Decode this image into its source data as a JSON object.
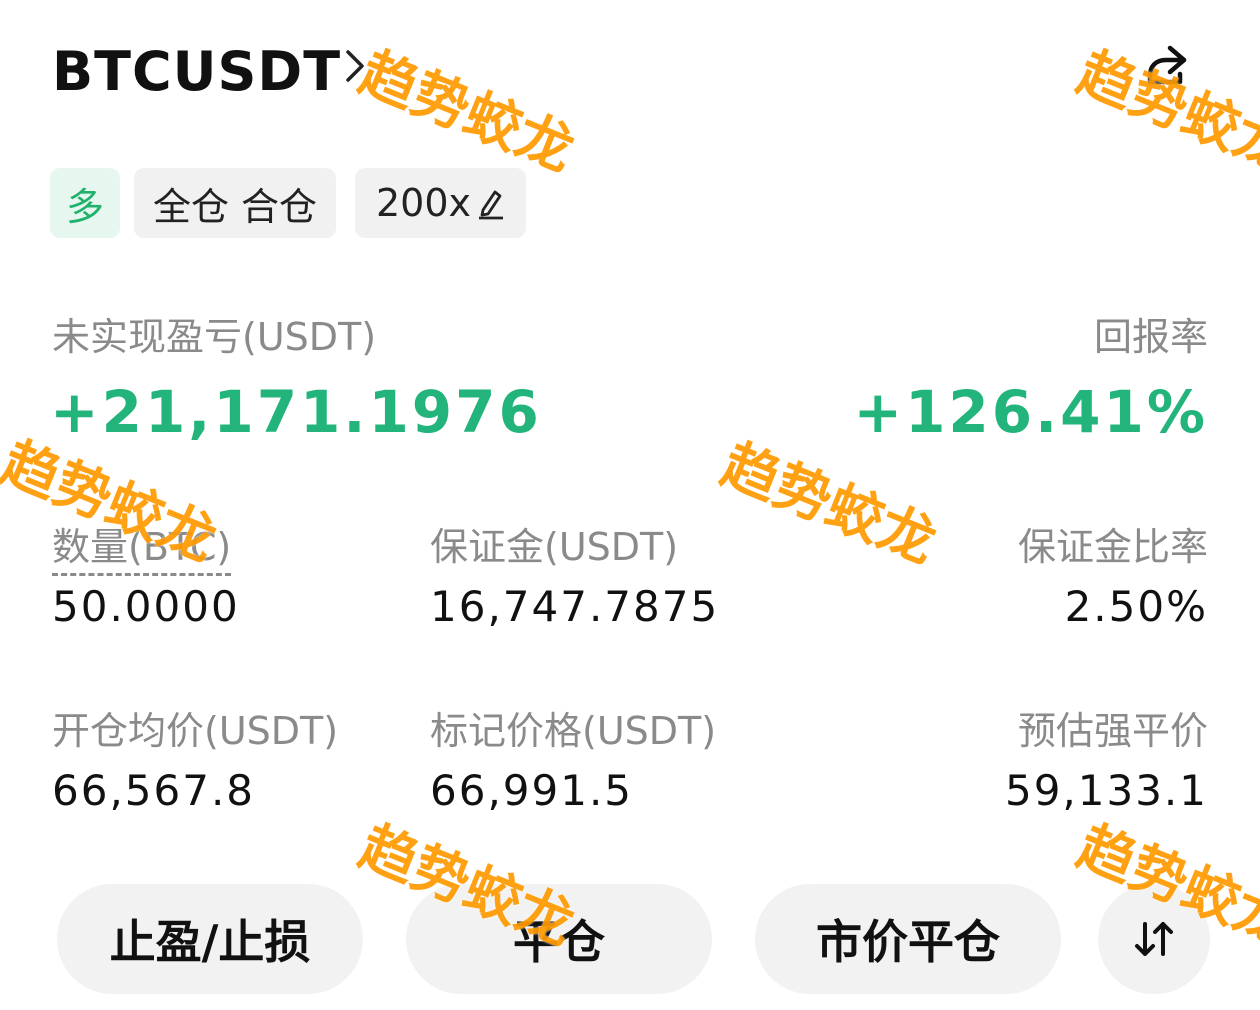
{
  "header": {
    "symbol": "BTCUSDT"
  },
  "tags": {
    "side": "多",
    "margin_mode": "全仓 合仓",
    "leverage": "200x"
  },
  "pnl": {
    "unrealized_label": "未实现盈亏(USDT)",
    "unrealized_value": "+21,171.1976",
    "roe_label": "回报率",
    "roe_value": "+126.41%"
  },
  "stats": {
    "qty_label": "数量(BTC)",
    "qty_value": "50.0000",
    "margin_label": "保证金(USDT)",
    "margin_value": "16,747.7875",
    "margin_ratio_label": "保证金比率",
    "margin_ratio_value": "2.50%",
    "entry_label": "开仓均价(USDT)",
    "entry_value": "66,567.8",
    "mark_label": "标记价格(USDT)",
    "mark_value": "66,991.5",
    "liq_label": "预估强平价",
    "liq_value": "59,133.1"
  },
  "actions": {
    "tpsl": "止盈/止损",
    "close": "平仓",
    "market_close": "市价平仓"
  },
  "watermark": "趋势蛟龙",
  "colors": {
    "profit": "#22b47a",
    "watermark": "#ff9a00",
    "label": "#8a8a8a"
  }
}
